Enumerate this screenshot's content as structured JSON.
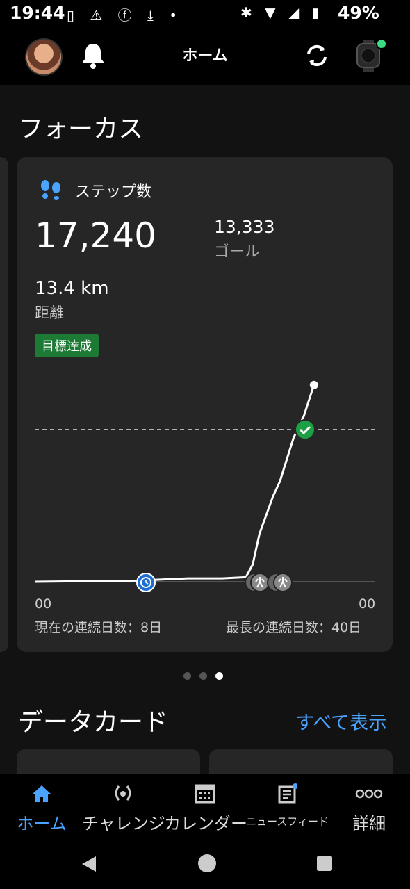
{
  "status_bar": {
    "time": "19:44",
    "left_icons": "▯ ⚠ ⓕ ⤓ •",
    "right_icons": "✱ ▼ ◢ ▮",
    "battery": "49%"
  },
  "header": {
    "title": "ホーム",
    "icons": [
      "avatar",
      "bell-icon",
      "sync-icon",
      "watch-icon"
    ],
    "watch_status_color": "#3ddc84"
  },
  "focus": {
    "section_title": "フォーカス",
    "card": {
      "title": "ステップ数",
      "steps": "17,240",
      "goal_value": "13,333",
      "goal_label": "ゴール",
      "distance_value": "13.4 km",
      "distance_label": "距離",
      "goal_badge": "目標達成",
      "axis_start": "00",
      "axis_end": "00",
      "current_streak": "現在の連続日数：8日",
      "longest_streak": "最長の連続日数：40日"
    },
    "pager": {
      "count": 3,
      "active_index": 2
    }
  },
  "data_cards": {
    "section_title": "データカード",
    "show_all": "すべて表示"
  },
  "bottom_nav": {
    "items": [
      {
        "label": "ホーム",
        "icon": "home-icon",
        "active": true
      },
      {
        "label": "チャレンジ",
        "icon": "laurel-icon",
        "active": false
      },
      {
        "label": "カレンダー",
        "icon": "calendar-icon",
        "active": false
      },
      {
        "label": "ニュースフィード",
        "icon": "newsfeed-icon",
        "active": false
      },
      {
        "label": "詳細",
        "icon": "more-icon",
        "active": false
      }
    ]
  },
  "colors": {
    "accent": "#4aa3ff",
    "goal_green": "#1d7a35",
    "check_green": "#1e9e45",
    "card_bg": "#262626"
  },
  "chart_data": {
    "type": "line",
    "series": [
      {
        "values_fraction_of_day": [
          0,
          0.3,
          0.45,
          0.55,
          0.62,
          0.64,
          0.66,
          0.7,
          0.72,
          0.76,
          0.79,
          0.82
        ],
        "values_steps": [
          0,
          100,
          300,
          300,
          400,
          1500,
          4200,
          7500,
          8800,
          12600,
          14500,
          17240
        ]
      }
    ],
    "goal_line": 13333
  }
}
